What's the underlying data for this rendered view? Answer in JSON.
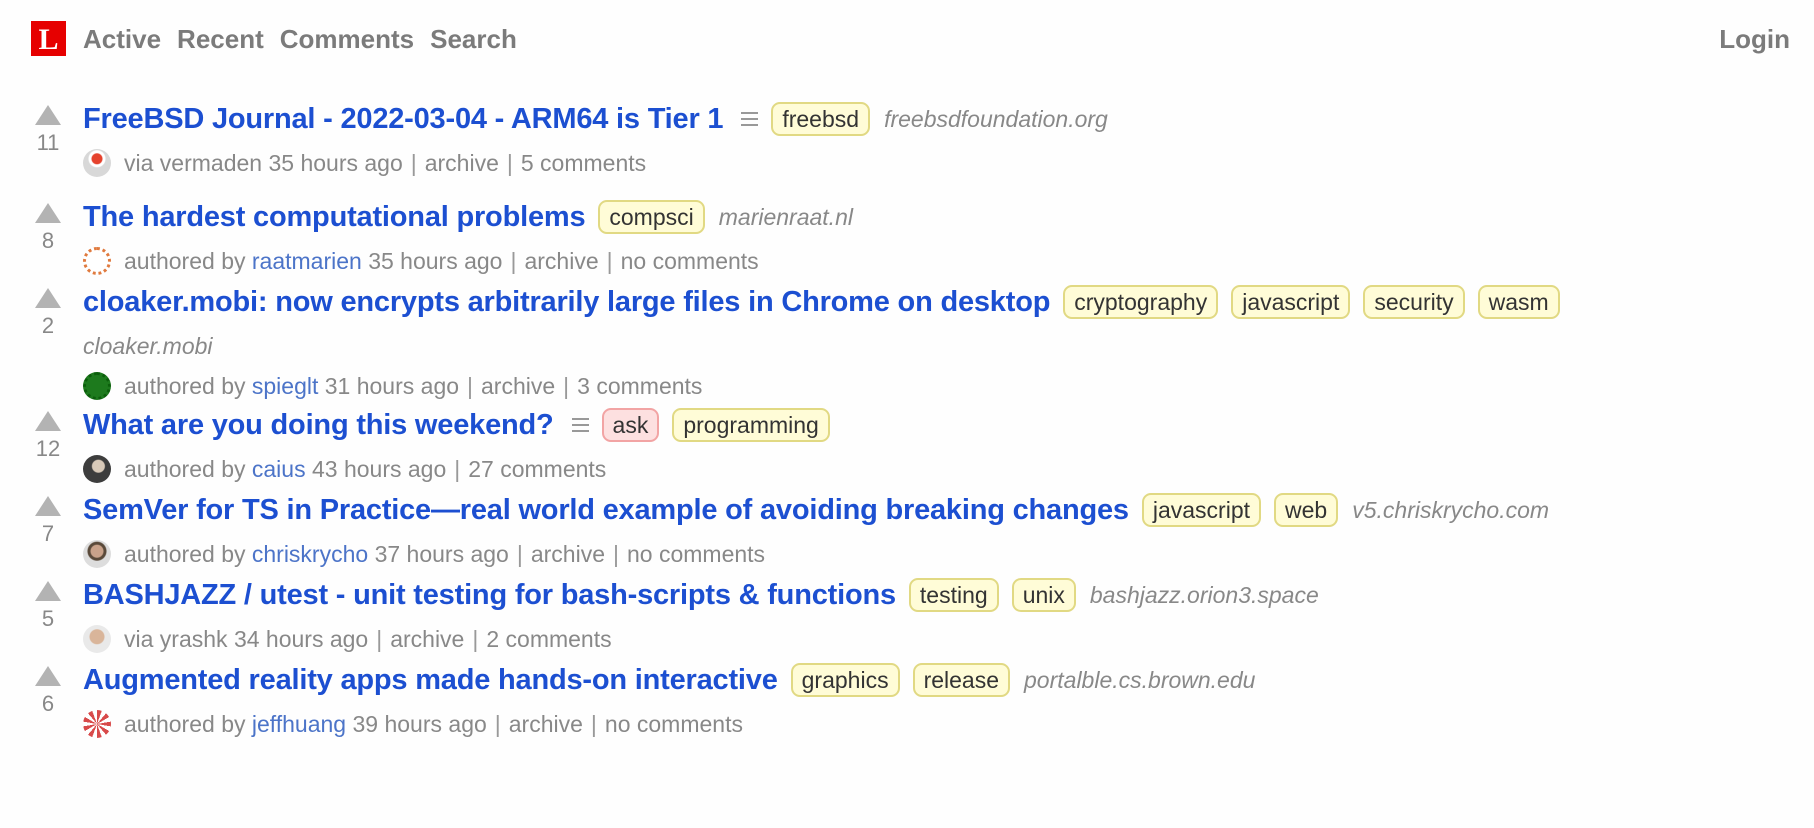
{
  "header": {
    "logo": "L",
    "nav": [
      "Active",
      "Recent",
      "Comments",
      "Search"
    ],
    "login": "Login"
  },
  "colors": {
    "logo": "#e60000",
    "title_link": "#1c4fd1",
    "user_link": "#4c74c8",
    "tag_bg": "#fffcd7",
    "tag_border": "#e1d983",
    "ask_tag_bg": "#fde0e0",
    "ask_tag_border": "#f2a4a4"
  },
  "stories": [
    {
      "score": "11",
      "title": "FreeBSD Journal - 2022-03-04 - ARM64 is Tier 1",
      "has_description": true,
      "tags": [
        "freebsd"
      ],
      "domain": "freebsdfoundation.org",
      "byline_prefix": "via",
      "user": "vermaden",
      "user_is_link": false,
      "time": "35 hours ago",
      "archive": "archive",
      "comments": "5 comments"
    },
    {
      "score": "8",
      "title": "The hardest computational problems",
      "has_description": false,
      "tags": [
        "compsci"
      ],
      "domain": "marienraat.nl",
      "byline_prefix": "authored by",
      "user": "raatmarien",
      "user_is_link": true,
      "time": "35 hours ago",
      "archive": "archive",
      "comments": "no comments"
    },
    {
      "score": "2",
      "title": "cloaker.mobi: now encrypts arbitrarily large files in Chrome on desktop",
      "has_description": false,
      "tags": [
        "cryptography",
        "javascript",
        "security",
        "wasm"
      ],
      "domain": "cloaker.mobi",
      "byline_prefix": "authored by",
      "user": "spieglt",
      "user_is_link": true,
      "time": "31 hours ago",
      "archive": "archive",
      "comments": "3 comments"
    },
    {
      "score": "12",
      "title": "What are you doing this weekend?",
      "has_description": true,
      "tags": [
        "ask",
        "programming"
      ],
      "domain": "",
      "byline_prefix": "authored by",
      "user": "caius",
      "user_is_link": true,
      "time": "43 hours ago",
      "archive": "",
      "comments": "27 comments"
    },
    {
      "score": "7",
      "title": "SemVer for TS in Practice—real world example of avoiding breaking changes",
      "has_description": false,
      "tags": [
        "javascript",
        "web"
      ],
      "domain": "v5.chriskrycho.com",
      "byline_prefix": "authored by",
      "user": "chriskrycho",
      "user_is_link": true,
      "time": "37 hours ago",
      "archive": "archive",
      "comments": "no comments"
    },
    {
      "score": "5",
      "title": "BASHJAZZ / utest - unit testing for bash-scripts & functions",
      "has_description": false,
      "tags": [
        "testing",
        "unix"
      ],
      "domain": "bashjazz.orion3.space",
      "byline_prefix": "via",
      "user": "yrashk",
      "user_is_link": false,
      "time": "34 hours ago",
      "archive": "archive",
      "comments": "2 comments"
    },
    {
      "score": "6",
      "title": "Augmented reality apps made hands-on interactive",
      "has_description": false,
      "tags": [
        "graphics",
        "release"
      ],
      "domain": "portalble.cs.brown.edu",
      "byline_prefix": "authored by",
      "user": "jeffhuang",
      "user_is_link": true,
      "time": "39 hours ago",
      "archive": "archive",
      "comments": "no comments"
    }
  ]
}
